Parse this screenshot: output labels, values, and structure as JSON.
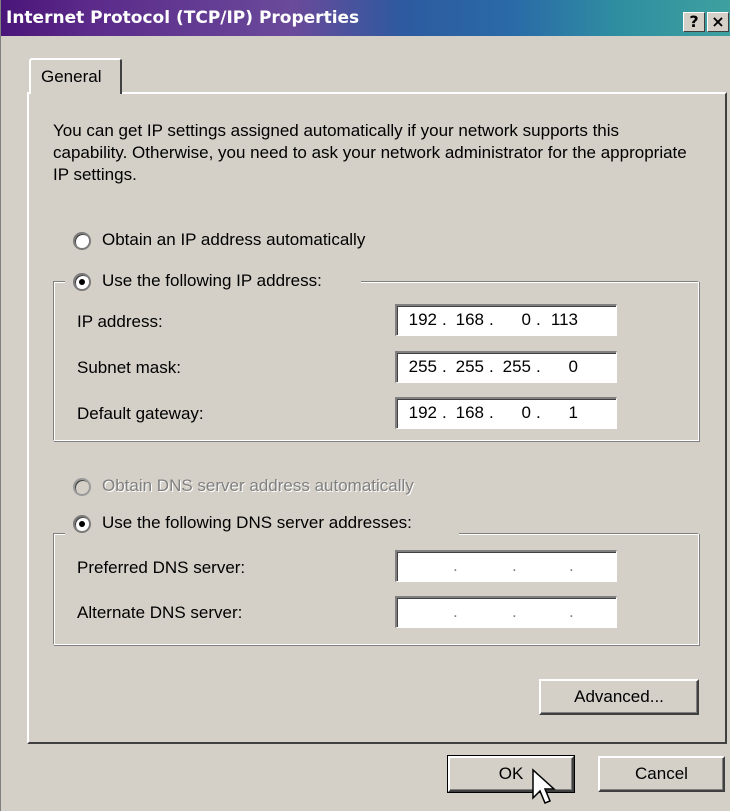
{
  "window": {
    "title": "Internet Protocol (TCP/IP) Properties",
    "help_button": "?",
    "close_button": "×"
  },
  "tabs": [
    {
      "label": "General",
      "selected": true
    }
  ],
  "description": "You can get IP settings assigned automatically if your network supports this capability. Otherwise, you need to ask your network administrator for the appropriate IP settings.",
  "ip": {
    "auto_label": "Obtain an IP address automatically",
    "manual_label": "Use the following IP address:",
    "mode": "manual",
    "fields": [
      {
        "label": "IP address:",
        "octets": [
          "192",
          "168",
          "0",
          "113"
        ]
      },
      {
        "label": "Subnet mask:",
        "octets": [
          "255",
          "255",
          "255",
          "0"
        ]
      },
      {
        "label": "Default gateway:",
        "octets": [
          "192",
          "168",
          "0",
          "1"
        ]
      }
    ]
  },
  "dns": {
    "auto_label": "Obtain DNS server address automatically",
    "auto_disabled": true,
    "manual_label": "Use the following DNS server addresses:",
    "mode": "manual",
    "fields": [
      {
        "label": "Preferred DNS server:",
        "octets": [
          "",
          "",
          "",
          ""
        ]
      },
      {
        "label": "Alternate DNS server:",
        "octets": [
          "",
          "",
          "",
          ""
        ]
      }
    ]
  },
  "buttons": {
    "advanced": "Advanced...",
    "ok": "OK",
    "cancel": "Cancel"
  },
  "colors": {
    "dialog_face": "#d4d0c8",
    "title_gradient_start": "#4a1578",
    "title_gradient_end": "#3fa0a0"
  }
}
